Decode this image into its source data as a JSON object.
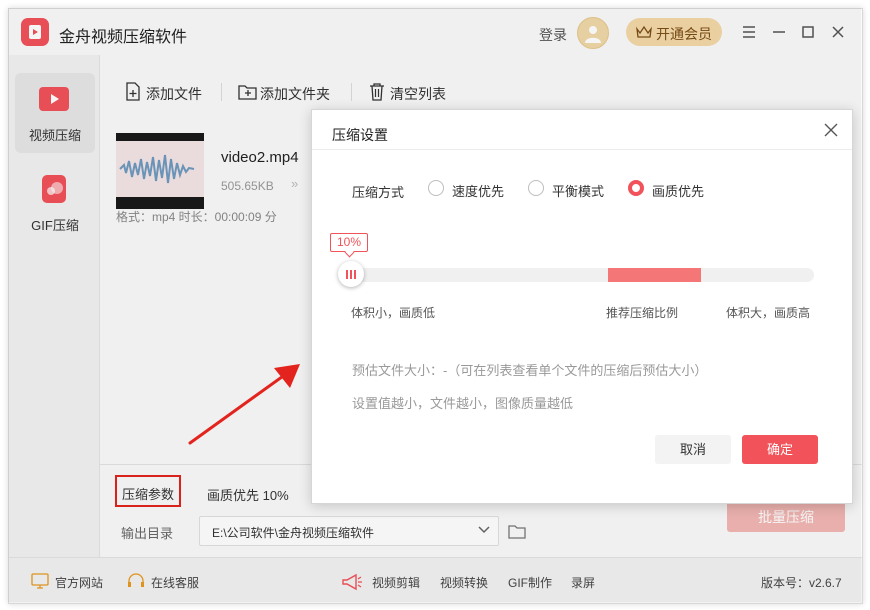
{
  "app": {
    "title": "金舟视频压缩软件",
    "login": "登录",
    "vip_button": "开通会员"
  },
  "sidebar": {
    "items": [
      {
        "label": "视频压缩",
        "icon": "video-compress-icon",
        "active": true
      },
      {
        "label": "GIF压缩",
        "icon": "gif-compress-icon",
        "active": false
      }
    ]
  },
  "toolbar": {
    "add_file": "添加文件",
    "add_folder": "添加文件夹",
    "clear_list": "清空列表"
  },
  "file": {
    "name": "video2.mp4",
    "size": "505.65KB",
    "arrow": "»",
    "meta": "格式：mp4    时长：00:00:09    分"
  },
  "params": {
    "label": "压缩参数",
    "value": "画质优先 10%",
    "output_label": "输出目录",
    "output_path": "E:\\公司软件\\金舟视频压缩软件",
    "batch_button": "批量压缩"
  },
  "statusbar": {
    "website": "官方网站",
    "service": "在线客服",
    "video_edit": "视频剪辑",
    "video_convert": "视频转换",
    "gif_make": "GIF制作",
    "record": "录屏",
    "version": "版本号：v2.6.7"
  },
  "dialog": {
    "title": "压缩设置",
    "mode_label": "压缩方式",
    "modes": [
      {
        "label": "速度优先",
        "selected": false
      },
      {
        "label": "平衡模式",
        "selected": false
      },
      {
        "label": "画质优先",
        "selected": true
      }
    ],
    "percent": "10%",
    "slider_value": 0.1,
    "scale_low": "体积小，画质低",
    "scale_recommend": "推荐压缩比例",
    "scale_high": "体积大，画质高",
    "estimate": "预估文件大小：-（可在列表查看单个文件的压缩后预估大小）",
    "hint": "设置值越小，文件越小，图像质量越低",
    "cancel": "取消",
    "confirm": "确定"
  },
  "colors": {
    "accent": "#f2525a",
    "recommend_zone": "#f47676",
    "annotation": "#e3241e",
    "vip_bg": "#f4d8a8"
  }
}
